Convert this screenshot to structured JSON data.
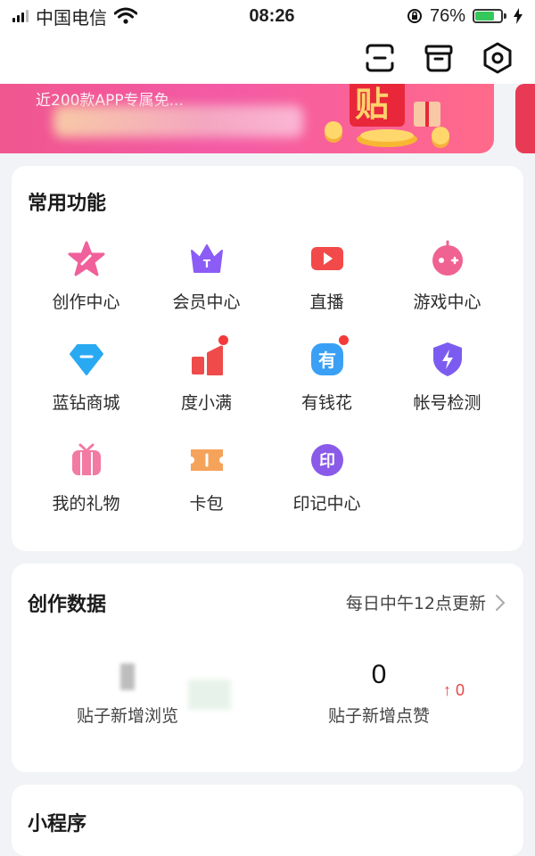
{
  "status_bar": {
    "carrier": "中国电信",
    "time": "08:26",
    "battery_percent": "76%",
    "battery_level": 0.76,
    "icons": [
      "signal-icon",
      "wifi-icon",
      "orientation-lock-icon",
      "battery-icon",
      "charging-icon"
    ]
  },
  "top_bar": {
    "icons": [
      "scan-icon",
      "box-icon",
      "settings-hexagon-icon"
    ]
  },
  "banner": {
    "text": "近200款APP专属免..."
  },
  "common_functions": {
    "title": "常用功能",
    "items": [
      {
        "label": "创作中心",
        "icon": "star-icon",
        "color": "#f0609a",
        "dot": false
      },
      {
        "label": "会员中心",
        "icon": "crown-icon",
        "color": "#8b5cf6",
        "dot": false
      },
      {
        "label": "直播",
        "icon": "video-camera-icon",
        "color": "#f24a4a",
        "dot": false
      },
      {
        "label": "游戏中心",
        "icon": "game-controller-icon",
        "color": "#f06292",
        "dot": false
      },
      {
        "label": "蓝钻商城",
        "icon": "diamond-icon",
        "color": "#29a9f2",
        "dot": false
      },
      {
        "label": "度小满",
        "icon": "finance-bars-icon",
        "color": "#ef4b4b",
        "dot": true
      },
      {
        "label": "有钱花",
        "icon": "money-you-icon",
        "color": "#3aa0f5",
        "dot": true
      },
      {
        "label": "帐号检测",
        "icon": "shield-bolt-icon",
        "color": "#7c5cf0",
        "dot": false
      },
      {
        "label": "我的礼物",
        "icon": "gift-icon",
        "color": "#f27aa3",
        "dot": false
      },
      {
        "label": "卡包",
        "icon": "ticket-icon",
        "color": "#f5a35b",
        "dot": false
      },
      {
        "label": "印记中心",
        "icon": "seal-yin-icon",
        "color": "#8a5ae8",
        "dot": false
      }
    ],
    "icon_glyphs": {
      "有": "有",
      "印": "印",
      "T": "T"
    }
  },
  "creation_data": {
    "title": "创作数据",
    "update_text": "每日中午12点更新",
    "stats": [
      {
        "label": "贴子新增浏览",
        "value": ""
      },
      {
        "label": "贴子新增点赞",
        "value": "0",
        "delta": "↑ 0"
      }
    ]
  },
  "mini_programs": {
    "title": "小程序"
  },
  "colors": {
    "background": "#f2f3f6",
    "card": "#ffffff",
    "banner_start": "#f0578f",
    "banner_end": "#ff6a8a",
    "accent_red": "#e94545"
  }
}
